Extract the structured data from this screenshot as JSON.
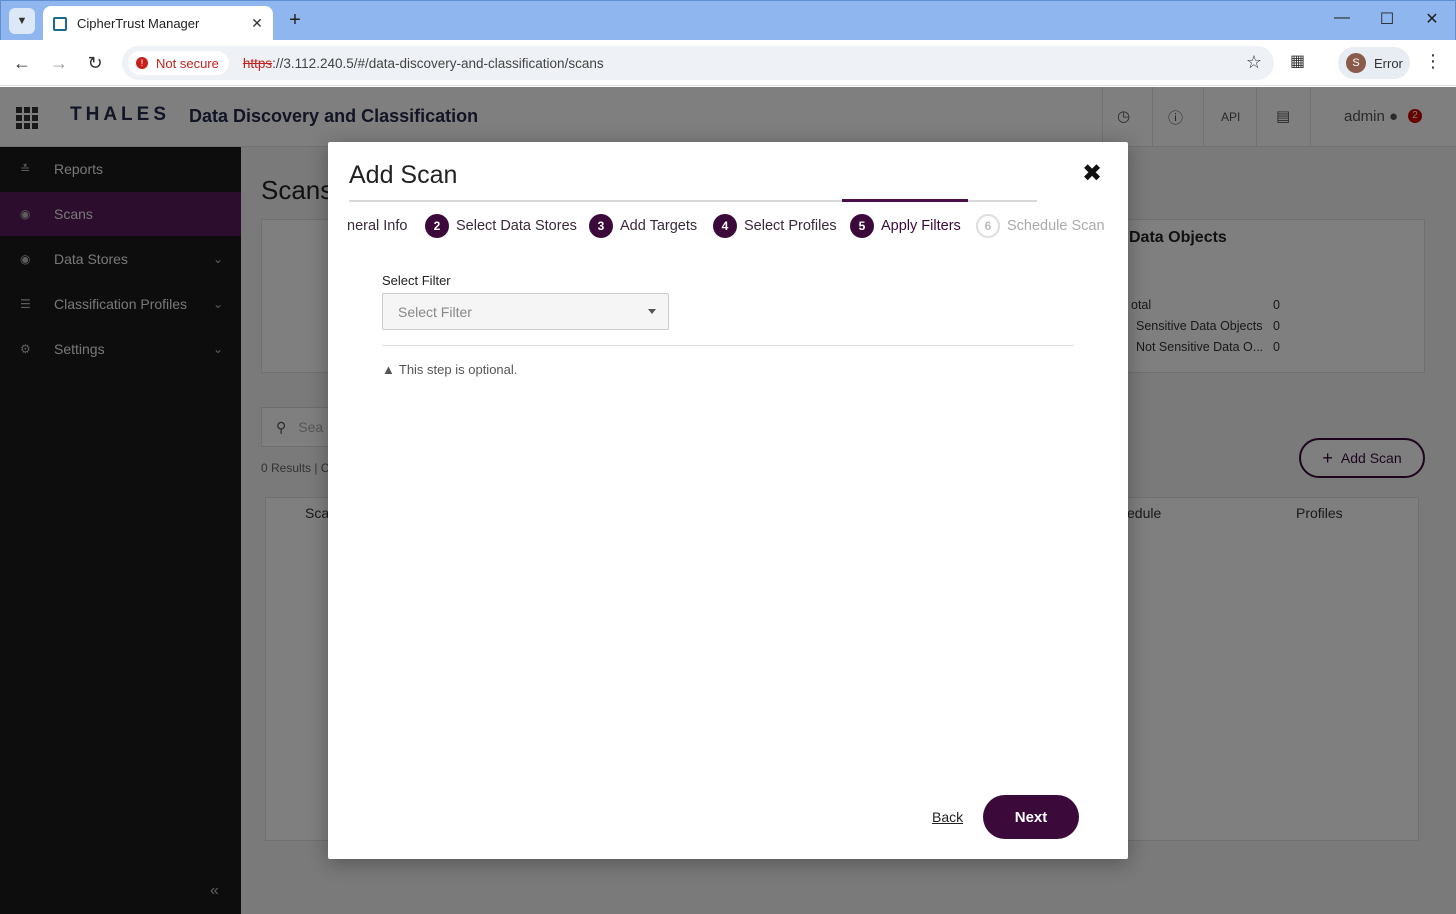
{
  "browser": {
    "tab_title": "CipherTrust Manager",
    "security_label": "Not secure",
    "url_scheme": "https",
    "url_rest": "://3.112.240.5/#/data-discovery-and-classification/scans",
    "profile_initial": "S",
    "profile_status": "Error"
  },
  "app": {
    "brand": "THALES",
    "title": "Data Discovery and Classification",
    "api_label": "API",
    "user": "admin",
    "notification_count": "2"
  },
  "sidebar": {
    "items": [
      {
        "label": "Reports"
      },
      {
        "label": "Scans"
      },
      {
        "label": "Data Stores"
      },
      {
        "label": "Classification Profiles"
      },
      {
        "label": "Settings"
      }
    ]
  },
  "page": {
    "title": "Scans",
    "summary_title": "Data Objects",
    "summary_rows": [
      {
        "label": "otal",
        "value": "0"
      },
      {
        "label": "Sensitive Data Objects",
        "value": "0"
      },
      {
        "label": "Not Sensitive Data O...",
        "value": "0"
      }
    ],
    "search_placeholder": "Sea",
    "results_text": "0 Results  |  C",
    "add_scan_label": "Add Scan",
    "columns": [
      "Sca",
      "edule",
      "Profiles"
    ]
  },
  "modal": {
    "title": "Add Scan",
    "steps": [
      {
        "num": "",
        "label": "neral Info"
      },
      {
        "num": "2",
        "label": "Select Data Stores"
      },
      {
        "num": "3",
        "label": "Add Targets"
      },
      {
        "num": "4",
        "label": "Select Profiles"
      },
      {
        "num": "5",
        "label": "Apply Filters"
      },
      {
        "num": "6",
        "label": "Schedule Scan"
      }
    ],
    "filter_label": "Select Filter",
    "filter_placeholder": "Select Filter",
    "optional_note": "This step is optional.",
    "back_label": "Back",
    "next_label": "Next"
  },
  "colors": {
    "accent": "#3b0a3b",
    "sidebar_bg": "#1a1a1a",
    "tabstrip_bg": "#8fb6ef"
  }
}
